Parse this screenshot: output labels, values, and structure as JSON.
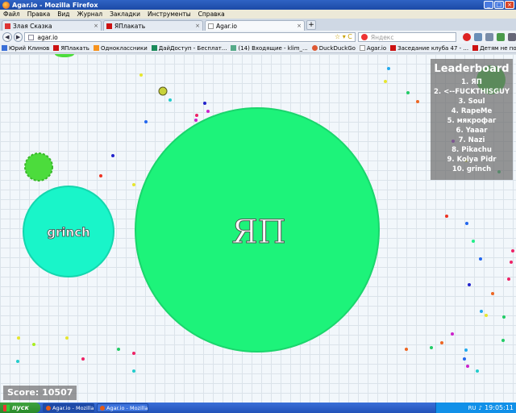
{
  "window": {
    "title": "Agar.io - Mozilla Firefox",
    "buttons": [
      "_",
      "□",
      "×"
    ]
  },
  "menu": [
    "Файл",
    "Правка",
    "Вид",
    "Журнал",
    "Закладки",
    "Инструменты",
    "Справка"
  ],
  "tabs": [
    {
      "label": "Злая Сказка",
      "close": "×",
      "fav_color": "#d33"
    },
    {
      "label": "ЯПлакать",
      "close": "×",
      "fav_color": "#c11"
    },
    {
      "label": "Agar.io",
      "close": "×",
      "fav_color": "#ffffff"
    }
  ],
  "new_tab_label": "+",
  "nav": {
    "back": "◀",
    "forward": "▶",
    "url": "agar.io",
    "star": "☆ ▾ C",
    "search_placeholder": "Яндекс"
  },
  "bookmarks": [
    {
      "label": "Юрий Клинов",
      "fav_color": "#3a6fd8"
    },
    {
      "label": "ЯПлакать",
      "fav_color": "#c11"
    },
    {
      "label": "Одноклассники",
      "fav_color": "#f7931e"
    },
    {
      "label": "ДайДоступ - Бесплат...",
      "fav_color": "#1a8a5a"
    },
    {
      "label": "(14) Входящие - klim_...",
      "fav_color": "#5a8"
    },
    {
      "label": "DuckDuckGo",
      "fav_color": "#de5833"
    },
    {
      "label": "Agar.io",
      "fav_color": "#ffffff"
    },
    {
      "label": "Заседание клуба 47 - ...",
      "fav_color": "#c11"
    },
    {
      "label": "Детям не показывать...",
      "fav_color": "#c11"
    }
  ],
  "game": {
    "leaderboard_title": "Leaderboard",
    "leaderboard": [
      "1. ЯП",
      "2. <--FUCKTHISGUY",
      "3. Soul",
      "4. RapeMe",
      "5. мякрофаг",
      "6. Yaaar",
      "7. Nazi",
      "8. Pikachu",
      "9. Kolya Pidr",
      "10. grinch"
    ],
    "score": "Score: 10507",
    "cells": {
      "big_name": "ЯП",
      "big_color": "#1df37a",
      "grinch_name": "grinch",
      "grinch_color": "#19f5c9",
      "virus_color": "#4cdc3c"
    }
  },
  "taskbar": {
    "start": "пуск",
    "tasks": [
      "Agar.io - Mozilla Fir...",
      "Agar.io - Mozilla Fir..."
    ],
    "lang": "RU",
    "clock": "19:05:11"
  }
}
